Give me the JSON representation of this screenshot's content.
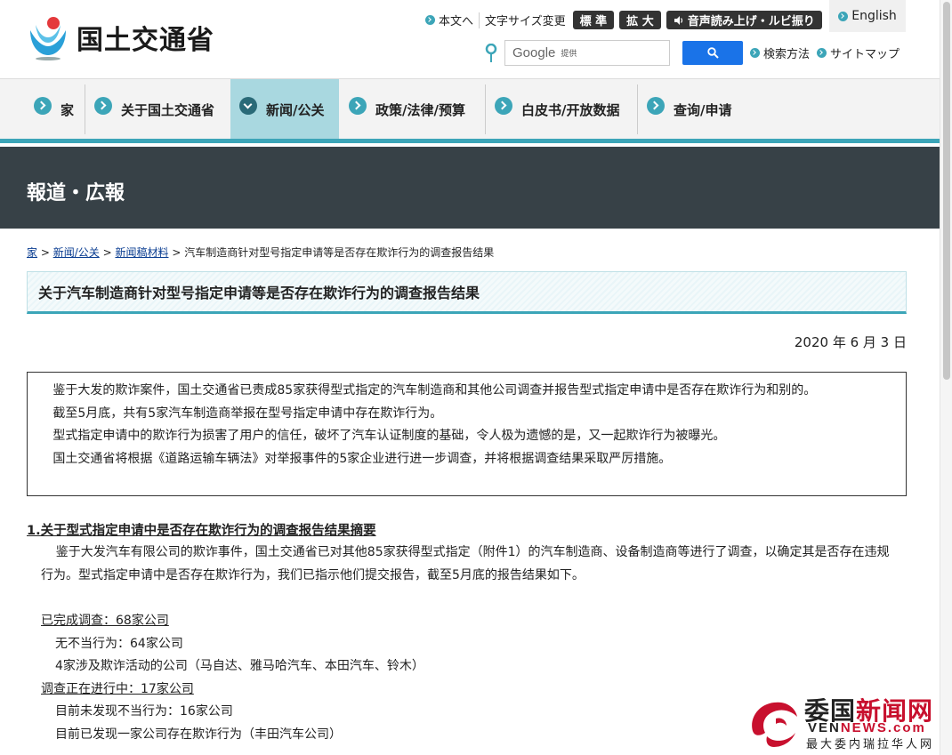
{
  "header": {
    "logo_text": "国土交通省",
    "main_text_link": "本文へ",
    "text_size_label": "文字サイズ変更",
    "size_standard": "標 準",
    "size_large": "拡 大",
    "speech_button": "音声読み上げ・ルビ振り",
    "english_link": "English",
    "search": {
      "brand": "Google",
      "provided": "提供",
      "search_method": "検索方法",
      "sitemap": "サイトマップ"
    }
  },
  "nav": {
    "items": [
      {
        "label": "家"
      },
      {
        "label": "关于国土交通省"
      },
      {
        "label": "新闻/公关"
      },
      {
        "label": "政策/法律/预算"
      },
      {
        "label": "白皮书/开放数据"
      },
      {
        "label": "查询/申请"
      }
    ]
  },
  "banner": {
    "title": "報道・広報"
  },
  "breadcrumb": {
    "home": "家",
    "news": "新闻/公关",
    "press": "新闻稿材料",
    "current": "汽车制造商针对型号指定申请等是否存在欺诈行为的调查报告结果"
  },
  "article": {
    "title": "关于汽车制造商针对型号指定申请等是否存在欺诈行为的调查报告结果",
    "date": "2020 年 6 月 3 日",
    "summary": [
      "鉴于大发的欺诈案件，国土交通省已责成85家获得型式指定的汽车制造商和其他公司调查并报告型式指定申请中是否存在欺诈行为和别的。",
      "截至5月底，共有5家汽车制造商举报在型号指定申请中存在欺诈行为。",
      "型式指定申请中的欺诈行为损害了用户的信任，破坏了汽车认证制度的基础，令人极为遗憾的是，又一起欺诈行为被曝光。",
      "国土交通省将根据《道路运输车辆法》对举报事件的5家企业进行进一步调查，并将根据调查结果采取严厉措施。"
    ],
    "section1_title": "1.关于型式指定申请中是否存在欺诈行为的调查报告结果摘要",
    "section1_body": "鉴于大发汽车有限公司的欺诈事件，国土交通省已对其他85家获得型式指定（附件1）的汽车制造商、设备制造商等进行了调查，以确定其是否存在违规行为。型式指定申请中是否存在欺诈行为，我们已指示他们提交报告，截至5月底的报告结果如下。",
    "completed": "已完成调查：68家公司",
    "no_misconduct": "无不当行为：64家公司",
    "fraud_companies": "4家涉及欺诈活动的公司（马自达、雅马哈汽车、本田汽车、铃木）",
    "in_progress": "调查正在进行中：17家公司",
    "none_found": "目前未发现不当行为：16家公司",
    "one_found": "目前已发现一家公司存在欺诈行为（丰田汽车公司）"
  },
  "watermark": {
    "name_a": "委国",
    "name_b": "新闻网",
    "url_a": "VEN",
    "url_b": "NEWS.com",
    "tagline": "最大委内瑞拉华人网"
  },
  "colors": {
    "accent": "#3ca5b8",
    "banner_bg": "#374147",
    "search_btn": "#1a73e8",
    "watermark_red": "#c8102e"
  }
}
